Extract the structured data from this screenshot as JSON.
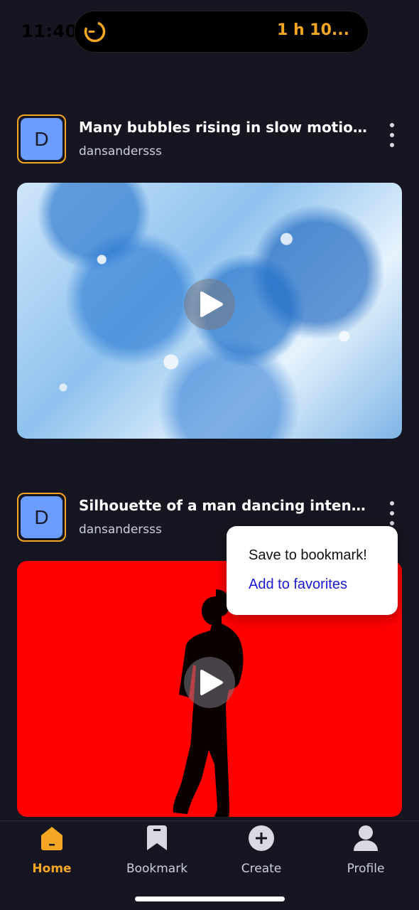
{
  "status_bar": {
    "time": "11:40",
    "activity_text": "1 h 10..."
  },
  "feed": [
    {
      "avatar_letter": "D",
      "title": "Many bubbles rising in slow motion i...",
      "author": "dansandersss",
      "thumbnail": "bubbles-video"
    },
    {
      "avatar_letter": "D",
      "title": "Silhouette of a man dancing intensel...",
      "author": "dansandersss",
      "thumbnail": "dancer-silhouette-video"
    }
  ],
  "popup": {
    "save_label": "Save to bookmark!",
    "favorites_label": "Add to favorites"
  },
  "nav": [
    {
      "label": "Home",
      "icon": "home-icon",
      "active": true
    },
    {
      "label": "Bookmark",
      "icon": "bookmark-icon",
      "active": false
    },
    {
      "label": "Create",
      "icon": "plus-circle-icon",
      "active": false
    },
    {
      "label": "Profile",
      "icon": "user-icon",
      "active": false
    }
  ],
  "colors": {
    "background": "#161622",
    "accent": "#f5a623",
    "avatar": "#6b9cff",
    "link": "#1a1ad6"
  }
}
